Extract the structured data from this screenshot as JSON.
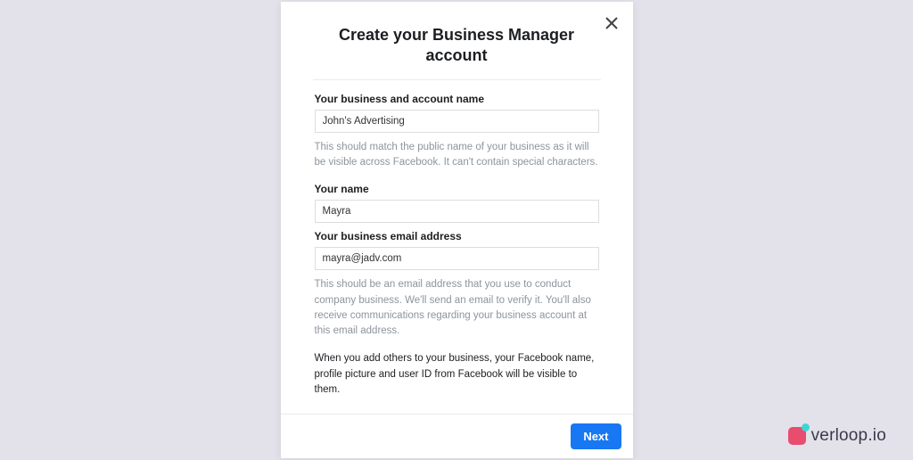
{
  "modal": {
    "title": "Create your Business Manager account",
    "fields": {
      "business_name": {
        "label": "Your business and account name",
        "value": "John's Advertising",
        "help": "This should match the public name of your business as it will be visible across Facebook. It can't contain special characters."
      },
      "your_name": {
        "label": "Your name",
        "value": "Mayra"
      },
      "business_email": {
        "label": "Your business email address",
        "value": "mayra@jadv.com",
        "help": "This should be an email address that you use to conduct company business. We'll send an email to verify it. You'll also receive communications regarding your business account at this email address."
      }
    },
    "notice": "When you add others to your business, your Facebook name, profile picture and user ID from Facebook will be visible to them.",
    "next_label": "Next"
  },
  "branding": {
    "text": "verloop.io"
  }
}
